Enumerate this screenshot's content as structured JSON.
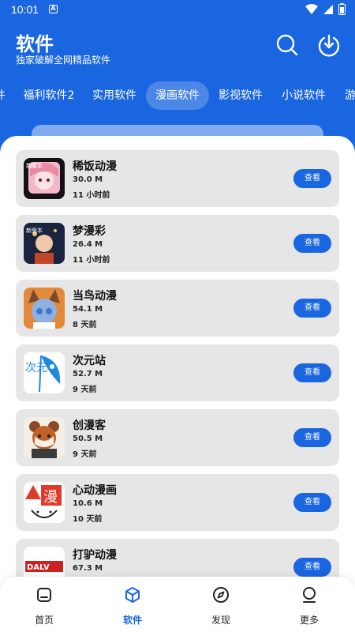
{
  "status": {
    "time": "10:01",
    "app_icon": "A"
  },
  "header": {
    "title": "软件",
    "subtitle": "独家破解全网精品软件"
  },
  "tabs": [
    "件",
    "福利软件2",
    "实用软件",
    "漫画软件",
    "影视软件",
    "小说软件",
    "游"
  ],
  "apps": [
    {
      "name": "稀饭动漫",
      "size": "30.0 M",
      "time": "11 小时前",
      "button": "查看"
    },
    {
      "name": "梦漫彩",
      "size": "26.4 M",
      "time": "11 小时前",
      "button": "查看"
    },
    {
      "name": "当鸟动漫",
      "size": "54.1 M",
      "time": "8 天前",
      "button": "查看"
    },
    {
      "name": "次元站",
      "size": "52.7 M",
      "time": "9 天前",
      "button": "查看"
    },
    {
      "name": "创漫客",
      "size": "50.5 M",
      "time": "9 天前",
      "button": "查看"
    },
    {
      "name": "心动漫画",
      "size": "10.6 M",
      "time": "10 天前",
      "button": "查看"
    },
    {
      "name": "打驴动漫",
      "size": "67.3 M",
      "time": "",
      "button": "查看"
    }
  ],
  "icon_badges": {
    "app0": "新版本",
    "app1": "新版本",
    "app3": "次元",
    "app5": "漫",
    "app6": "DALV"
  },
  "nav": [
    "首页",
    "软件",
    "发现",
    "更多"
  ],
  "colors": {
    "primary": "#1a66e0",
    "card_bg": "#e6e6e6"
  }
}
